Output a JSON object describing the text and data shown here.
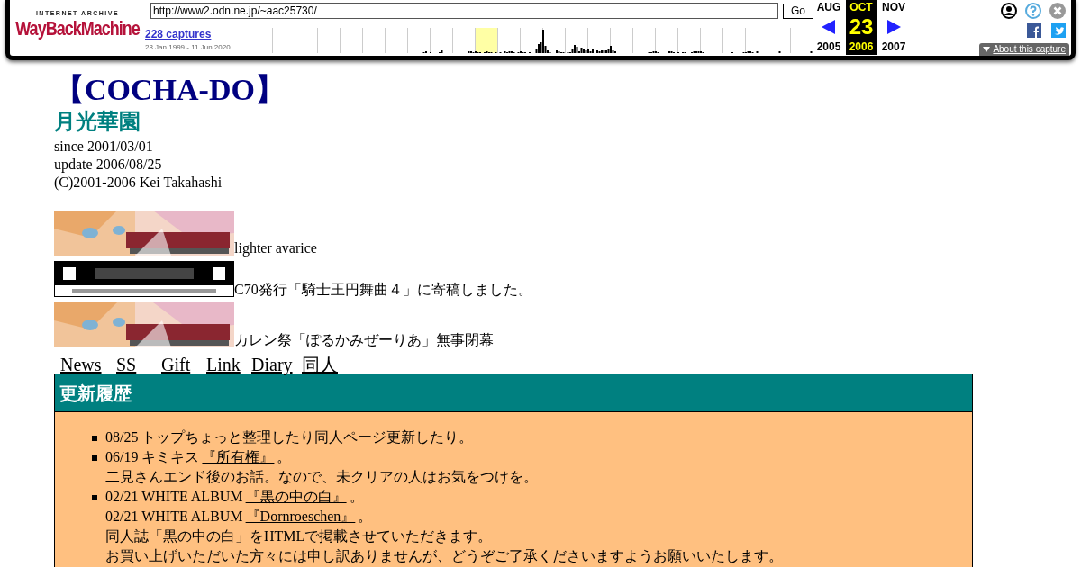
{
  "toolbar": {
    "logo_top": "INTERNET ARCHIVE",
    "logo_main": "WayBackMachine",
    "url": "http://www2.odn.ne.jp/~aac25730/",
    "go": "Go",
    "captures": "228 captures",
    "date_range": "28 Jan 1999 - 11 Jun 2020",
    "months": [
      {
        "month": "AUG",
        "year": "2005",
        "selected": false
      },
      {
        "month": "OCT",
        "year": "2006",
        "selected": true,
        "day": "23"
      },
      {
        "month": "NOV",
        "year": "2007",
        "selected": false
      }
    ],
    "about": "About this capture"
  },
  "page": {
    "title": "【COCHA-DO】",
    "subtitle": "月光華園",
    "info": [
      "since 2001/03/01",
      "update 2006/08/25",
      "(C)2001-2006 Kei Takahashi"
    ],
    "banners": [
      {
        "caption": "lighter avarice"
      },
      {
        "caption": "C70発行「騎士王円舞曲４」に寄稿しました。"
      },
      {
        "caption": "カレン祭「ぽるかみぜーりあ」無事閉幕"
      }
    ],
    "nav": [
      "News",
      "SS",
      "Gift",
      "Link",
      "Diary",
      "同人"
    ],
    "news": {
      "heading": "更新履歴",
      "items": [
        {
          "lines": [
            {
              "text": "08/25 トップちょっと整理したり同人ページ更新したり。"
            }
          ]
        },
        {
          "lines": [
            {
              "text": "06/19 キミキス",
              "link": "『所有権』",
              "after": "。"
            },
            {
              "text": "二見さんエンド後のお話。なので、未クリアの人はお気をつけを。"
            }
          ]
        },
        {
          "lines": [
            {
              "text": "02/21 WHITE ALBUM",
              "link": "『黒の中の白』",
              "after": "。"
            },
            {
              "text": "02/21 WHITE ALBUM",
              "link": "『Dornroeschen』",
              "after": "。"
            },
            {
              "text": "同人誌「黒の中の白」をHTMLで掲載させていただきます。"
            },
            {
              "text": "お買い上げいただいた方々には申し訳ありませんが、どうぞご了承くださいますようお願いいたします。"
            }
          ]
        }
      ]
    }
  }
}
